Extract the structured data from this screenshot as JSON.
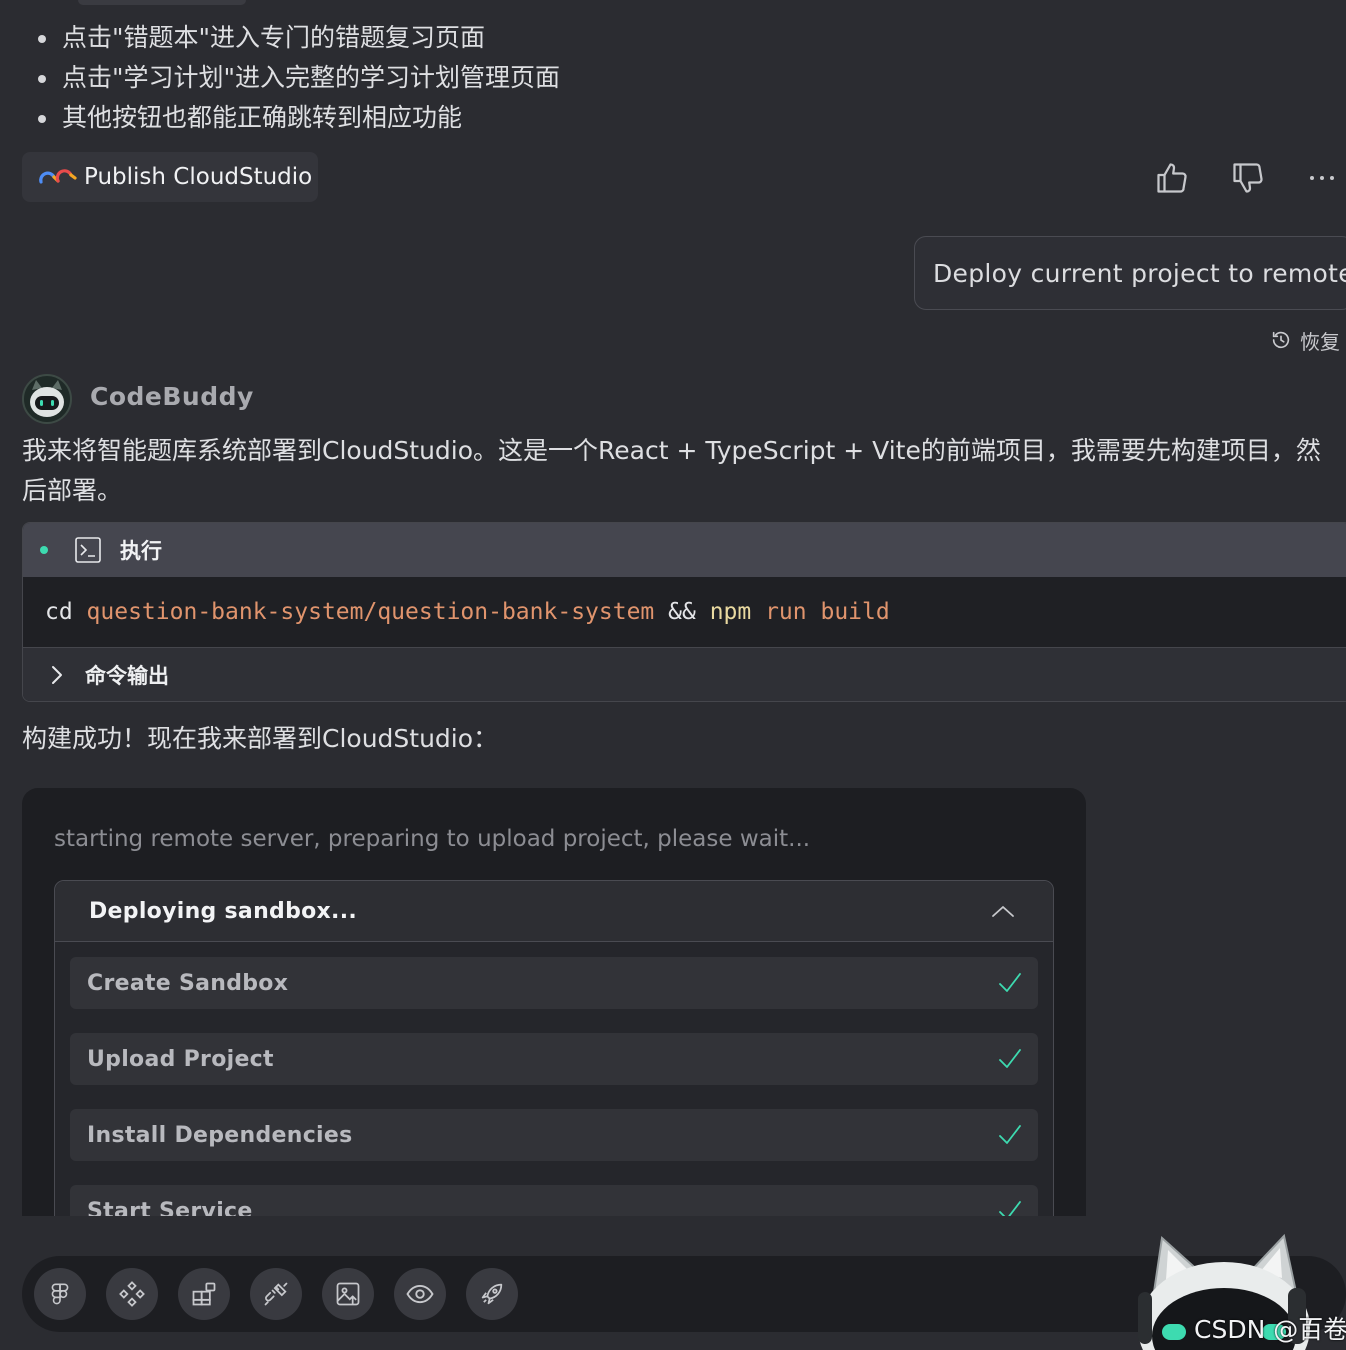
{
  "bullets": [
    "点击\"错题本\"进入专门的错题复习页面",
    "点击\"学习计划\"进入完整的学习计划管理页面",
    "其他按钮也都能正确跳转到相应功能"
  ],
  "publish_button": {
    "label": "Publish CloudStudio"
  },
  "feedback": {
    "like_icon": "thumbs-up-icon",
    "dislike_icon": "thumbs-down-icon",
    "more_icon": "more-icon"
  },
  "user_message": {
    "text": "Deploy current project to remote"
  },
  "restore": {
    "label": "恢复",
    "icon": "history-icon"
  },
  "agent": {
    "name": "CodeBuddy",
    "intro": "我来将智能题库系统部署到CloudStudio。这是一个React + TypeScript + Vite的前端项目，我需要先构建项目，然后部署。",
    "after_build": "构建成功！现在我来部署到CloudStudio："
  },
  "exec": {
    "title": "执行",
    "command_tokens": [
      {
        "text": "cd ",
        "color": "#e4e5e8"
      },
      {
        "text": "question-bank-system/question-bank-system ",
        "color": "#e0946d"
      },
      {
        "text": "&& ",
        "color": "#e4e5e8"
      },
      {
        "text": "npm ",
        "color": "#e9d9a0"
      },
      {
        "text": "run build",
        "color": "#e0946d"
      }
    ],
    "output_label": "命令输出"
  },
  "deploy": {
    "status": "starting remote server, preparing to upload project, please wait...",
    "panel_title": "Deploying sandbox...",
    "steps": [
      {
        "label": "Create Sandbox",
        "done": true
      },
      {
        "label": "Upload Project",
        "done": true
      },
      {
        "label": "Install Dependencies",
        "done": true
      },
      {
        "label": "Start Service",
        "done": true
      }
    ]
  },
  "toolbar": {
    "buttons": [
      "figma-icon",
      "components-icon",
      "grid-add-icon",
      "plug-icon",
      "image-upload-icon",
      "eye-icon",
      "rocket-icon"
    ]
  },
  "watermark": "CSDN @百卷",
  "colors": {
    "accent": "#3ddbb0",
    "background": "#2b2c31",
    "card": "#1d1e22"
  }
}
